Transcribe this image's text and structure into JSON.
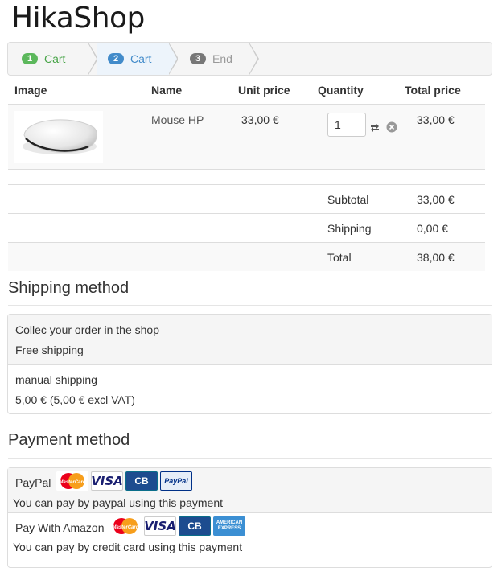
{
  "site": {
    "title": "HikaShop"
  },
  "steps": [
    {
      "number": "1",
      "label": "Cart"
    },
    {
      "number": "2",
      "label": "Cart"
    },
    {
      "number": "3",
      "label": "End"
    }
  ],
  "cart": {
    "headers": {
      "image": "Image",
      "name": "Name",
      "unit_price": "Unit price",
      "quantity": "Quantity",
      "total_price": "Total price"
    },
    "items": [
      {
        "name": "Mouse HP",
        "unit_price": "33,00 €",
        "quantity": "1",
        "total_price": "33,00 €"
      }
    ],
    "totals": {
      "subtotal_label": "Subtotal",
      "subtotal_value": "33,00 €",
      "shipping_label": "Shipping",
      "shipping_value": "0,00 €",
      "total_label": "Total",
      "total_value": "38,00 €"
    }
  },
  "shipping": {
    "title": "Shipping method",
    "options": [
      {
        "name": "Collec your order in the shop",
        "price": "Free shipping"
      },
      {
        "name": "manual shipping",
        "price": "5,00 € (5,00 € excl VAT)"
      }
    ]
  },
  "payment": {
    "title": "Payment method",
    "options": [
      {
        "name": "PayPal",
        "description": "You can pay by paypal using this payment"
      },
      {
        "name": "Pay With Amazon",
        "description": "You can pay by credit card using this payment"
      }
    ],
    "logos": {
      "mastercard": "MasterCard",
      "visa": "VISA",
      "cb": "CB",
      "paypal": "PayPal",
      "amex_line1": "AMERICAN",
      "amex_line2": "EXPRESS"
    }
  },
  "colors": {
    "step_done": "#5cb85c",
    "step_current": "#428bca",
    "step_pending": "#777777"
  }
}
